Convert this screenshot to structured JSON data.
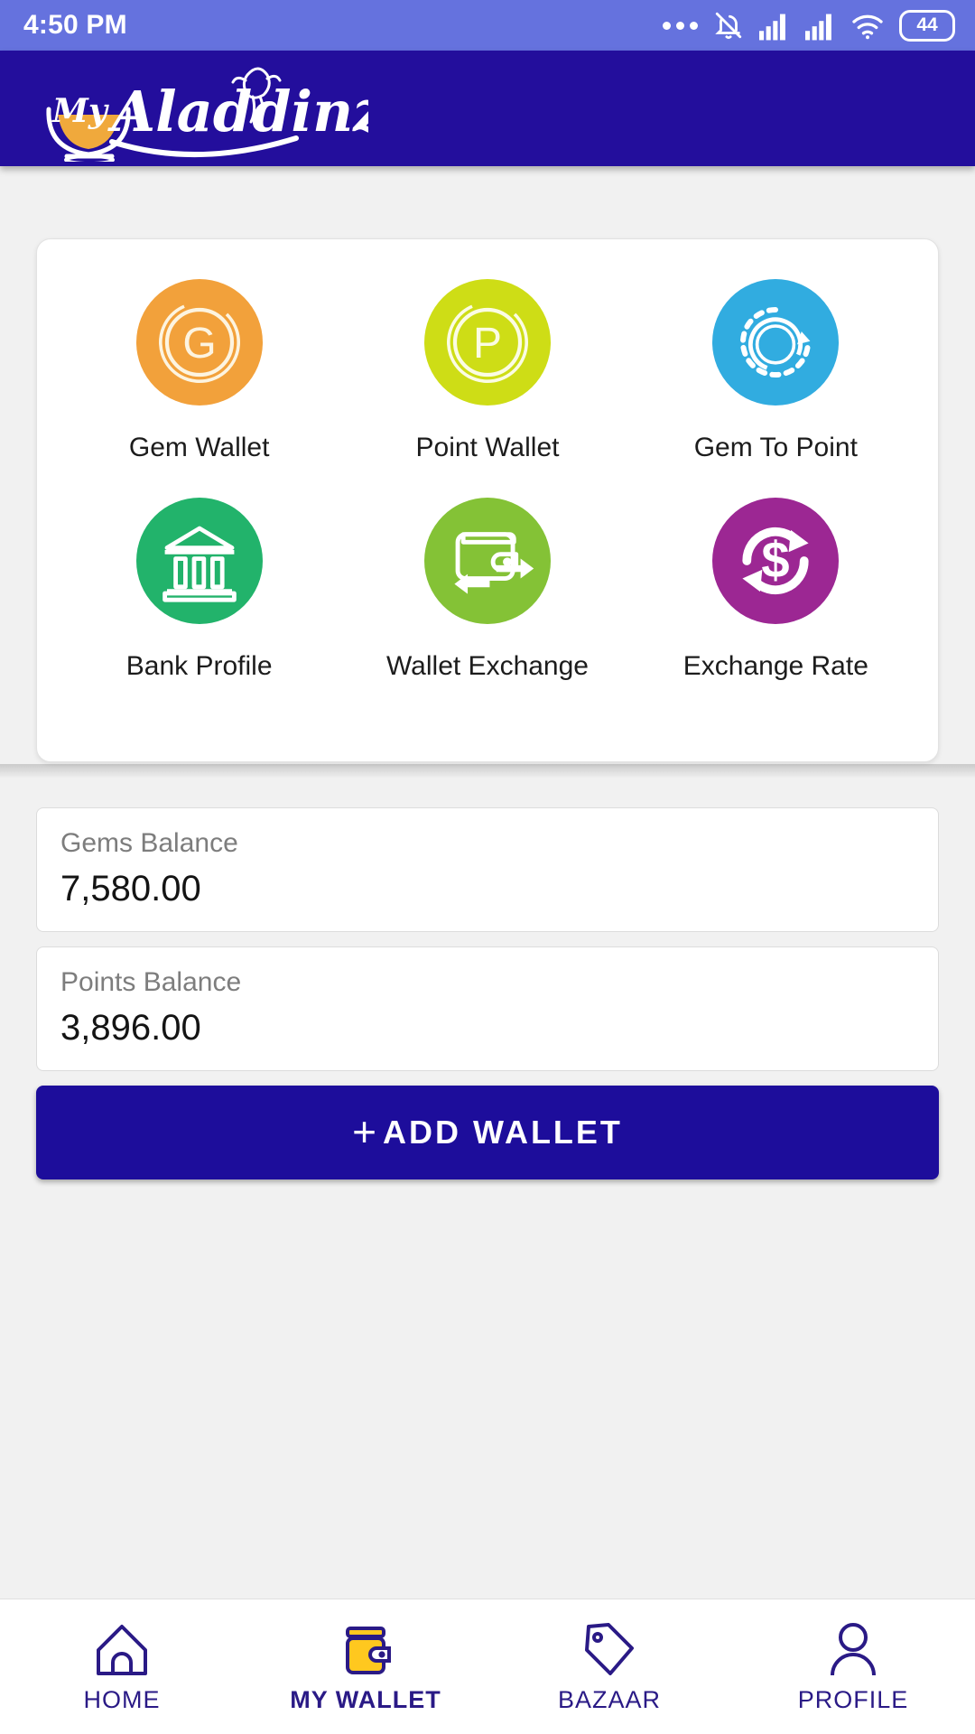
{
  "status_bar": {
    "time": "4:50 PM",
    "battery_level": "44",
    "icons": [
      "more-dots-icon",
      "bell-muted-icon",
      "signal-bars-1-icon",
      "signal-bars-2-icon",
      "wifi-icon",
      "battery-icon"
    ]
  },
  "header": {
    "app_name": "My Aladdinz",
    "logo_text_primary": "My",
    "logo_text_secondary": "Aladdinz",
    "background_color": "#230e9c"
  },
  "menu": {
    "items": [
      {
        "id": "gem-wallet",
        "label": "Gem Wallet",
        "icon": "gem-coin-icon",
        "color": "#f2a13b",
        "glyph": "G"
      },
      {
        "id": "point-wallet",
        "label": "Point Wallet",
        "icon": "point-coin-icon",
        "color": "#cedd16",
        "glyph": "P"
      },
      {
        "id": "gem-to-point",
        "label": "Gem To Point",
        "icon": "convert-circle-icon",
        "color": "#31ace0",
        "glyph": ""
      },
      {
        "id": "bank-profile",
        "label": "Bank Profile",
        "icon": "bank-building-icon",
        "color": "#22b36b",
        "glyph": ""
      },
      {
        "id": "wallet-exchange",
        "label": "Wallet Exchange",
        "icon": "wallet-exchange-icon",
        "color": "#84c236",
        "glyph": ""
      },
      {
        "id": "exchange-rate",
        "label": "Exchange Rate",
        "icon": "dollar-refresh-icon",
        "color": "#9c2793",
        "glyph": "$"
      }
    ]
  },
  "balances": {
    "gems": {
      "label": "Gems Balance",
      "value": "7,580.00"
    },
    "points": {
      "label": "Points Balance",
      "value": "3,896.00"
    }
  },
  "actions": {
    "add_wallet_label": "ADD WALLET",
    "add_wallet_plus": "+",
    "add_wallet_color": "#1d0d9b"
  },
  "bottom_nav": {
    "active_index": 1,
    "items": [
      {
        "id": "home",
        "label": "HOME",
        "icon": "home-icon"
      },
      {
        "id": "my-wallet",
        "label": "MY WALLET",
        "icon": "wallet-icon"
      },
      {
        "id": "bazaar",
        "label": "BAZAAR",
        "icon": "price-tag-icon"
      },
      {
        "id": "profile",
        "label": "PROFILE",
        "icon": "person-icon"
      }
    ]
  },
  "theme": {
    "brand_navy": "#230e9c",
    "status_bar_blue": "#6572de",
    "page_background": "#f1f1f1",
    "nav_accent": "#2a1a86",
    "wallet_yellow": "#ffc81f"
  }
}
